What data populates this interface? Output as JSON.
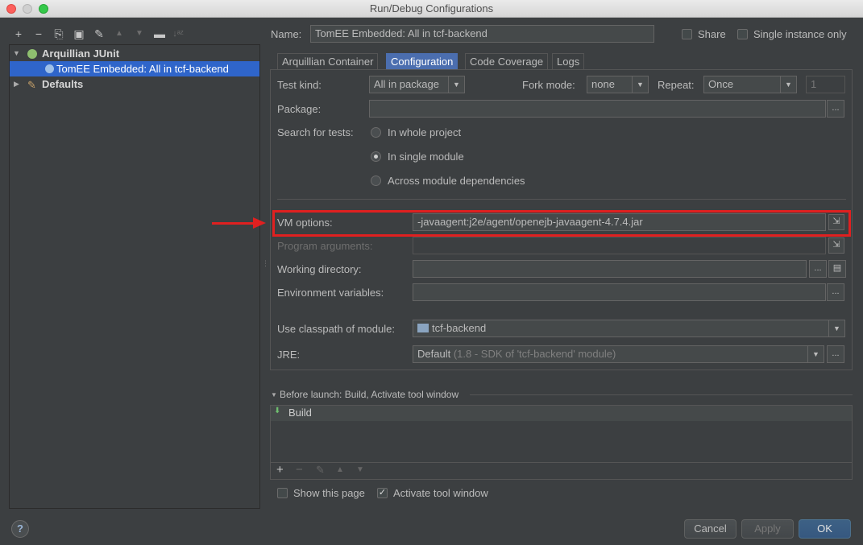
{
  "window": {
    "title": "Run/Debug Configurations"
  },
  "toolbar": {
    "add": "+",
    "remove": "−",
    "copy": "⎘",
    "save": "▣",
    "edit": "✎",
    "up": "▲",
    "down": "▼",
    "folder": "▬",
    "sort": "↓ᵃᶻ"
  },
  "tree": {
    "group_label": "Arquillian JUnit",
    "config_label": "TomEE Embedded: All in tcf-backend",
    "defaults_label": "Defaults"
  },
  "header": {
    "name_label": "Name:",
    "name_value": "TomEE Embedded: All in tcf-backend",
    "share_label": "Share",
    "single_instance_label": "Single instance only"
  },
  "tabs": [
    {
      "label": "Arquillian Container"
    },
    {
      "label": "Configuration"
    },
    {
      "label": "Code Coverage"
    },
    {
      "label": "Logs"
    }
  ],
  "form": {
    "test_kind_label": "Test kind:",
    "test_kind_value": "All in package",
    "fork_mode_label": "Fork mode:",
    "fork_mode_value": "none",
    "repeat_label": "Repeat:",
    "repeat_value": "Once",
    "repeat_count": "1",
    "package_label": "Package:",
    "package_value": "",
    "search_label": "Search for tests:",
    "search_options": [
      "In whole project",
      "In single module",
      "Across module dependencies"
    ],
    "vm_options_label": "VM options:",
    "vm_options_value": "-javaagent:j2e/agent/openejb-javaagent-4.7.4.jar",
    "program_args_label": "Program arguments:",
    "working_dir_label": "Working directory:",
    "env_vars_label": "Environment variables:",
    "classpath_label": "Use classpath of module:",
    "classpath_value": "tcf-backend",
    "jre_label": "JRE:",
    "jre_value": "Default",
    "jre_detail": "(1.8 - SDK of 'tcf-backend' module)",
    "ellipsis": "..."
  },
  "before_launch": {
    "header": "Before launch: Build, Activate tool window",
    "items": [
      "Build"
    ],
    "show_page_label": "Show this page",
    "activate_label": "Activate tool window"
  },
  "buttons": {
    "cancel": "Cancel",
    "apply": "Apply",
    "ok": "OK",
    "help": "?"
  },
  "colors": {
    "accent": "#4b6eaf",
    "selection": "#2f65ca",
    "highlight": "#e02020"
  }
}
